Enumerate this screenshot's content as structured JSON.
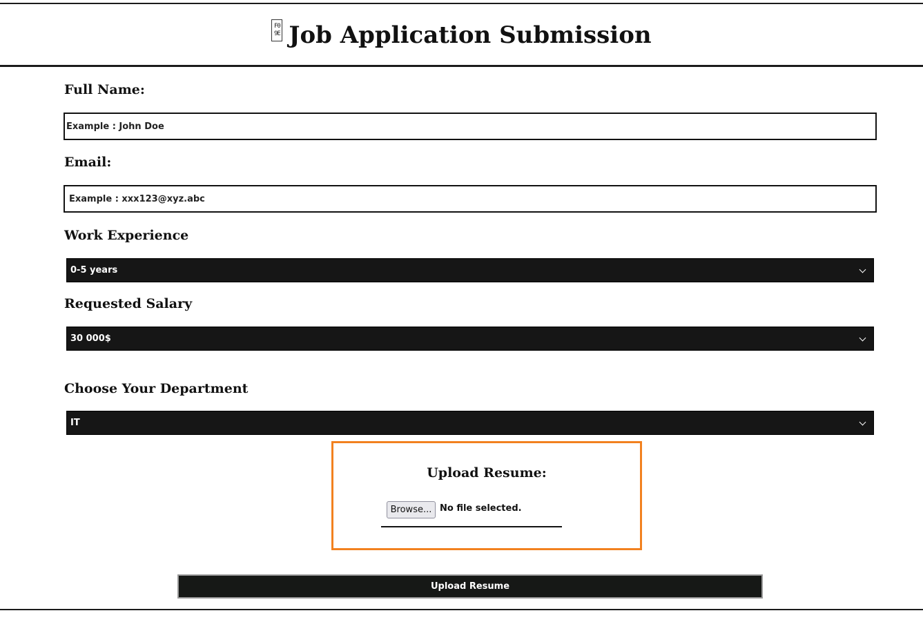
{
  "header": {
    "title_glyph": "F0 9E",
    "title": "Job Application Submission"
  },
  "form": {
    "full_name": {
      "label": "Full Name:",
      "placeholder": "Example : John Doe"
    },
    "email": {
      "label": "Email:",
      "placeholder": "Example : xxx123@xyz.abc"
    },
    "experience": {
      "label": "Work Experience",
      "selected": "0-5 years"
    },
    "salary": {
      "label": "Requested Salary",
      "selected": "30 000$"
    },
    "department": {
      "label": "Choose Your Department",
      "selected": "IT"
    },
    "resume": {
      "label": "Upload Resume:",
      "browse_label": "Browse...",
      "file_status": "No file selected."
    },
    "submit_label": "Upload Resume"
  },
  "colors": {
    "upload_border": "#f2811f",
    "select_bg": "#161616",
    "text": "#111111"
  }
}
